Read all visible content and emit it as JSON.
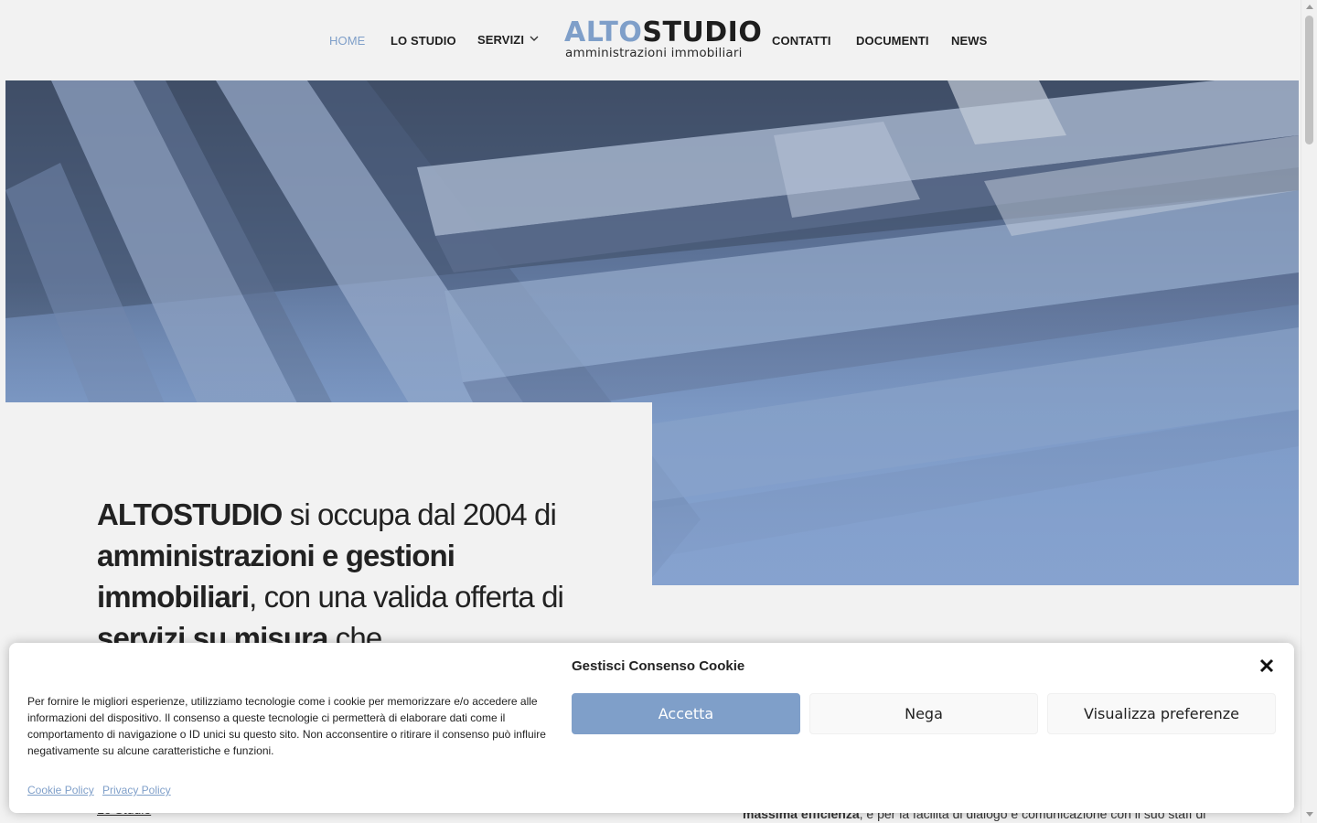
{
  "nav": {
    "home": "HOME",
    "studio": "LO STUDIO",
    "servizi": "SERVIZI",
    "contatti": "CONTATTI",
    "documenti": "DOCUMENTI",
    "news": "NEWS"
  },
  "logo": {
    "alto": "ALTO",
    "studio": "STUDIO",
    "subtitle": "amministrazioni immobiliari"
  },
  "intro": {
    "brand": "ALTOSTUDIO",
    "t1": " si occupa dal 2004 di ",
    "b1": "amministrazioni e gestioni immobiliari",
    "t2": ", con una valida offerta di ",
    "b2": "servizi su misura",
    "t3": " che"
  },
  "page": {
    "link_lostudio": "Lo Studio",
    "bottom_bold": "massima efficienza",
    "bottom_text": ", e per la facilità di dialogo e comunicazione con il suo staff di"
  },
  "cookie": {
    "title": "Gestisci Consenso Cookie",
    "text": "Per fornire le migliori esperienze, utilizziamo tecnologie come i cookie per memorizzare e/o accedere alle informazioni del dispositivo. Il consenso a queste tecnologie ci permetterà di elaborare dati come il comportamento di navigazione o ID unici su questo sito. Non acconsentire o ritirare il consenso può influire negativamente su alcune caratteristiche e funzioni.",
    "accept": "Accetta",
    "deny": "Nega",
    "preferences": "Visualizza preferenze",
    "cookie_policy": "Cookie Policy",
    "privacy_policy": "Privacy Policy"
  },
  "colors": {
    "accent": "#7f9fc9",
    "text": "#222222",
    "background": "#f2f2f2"
  }
}
